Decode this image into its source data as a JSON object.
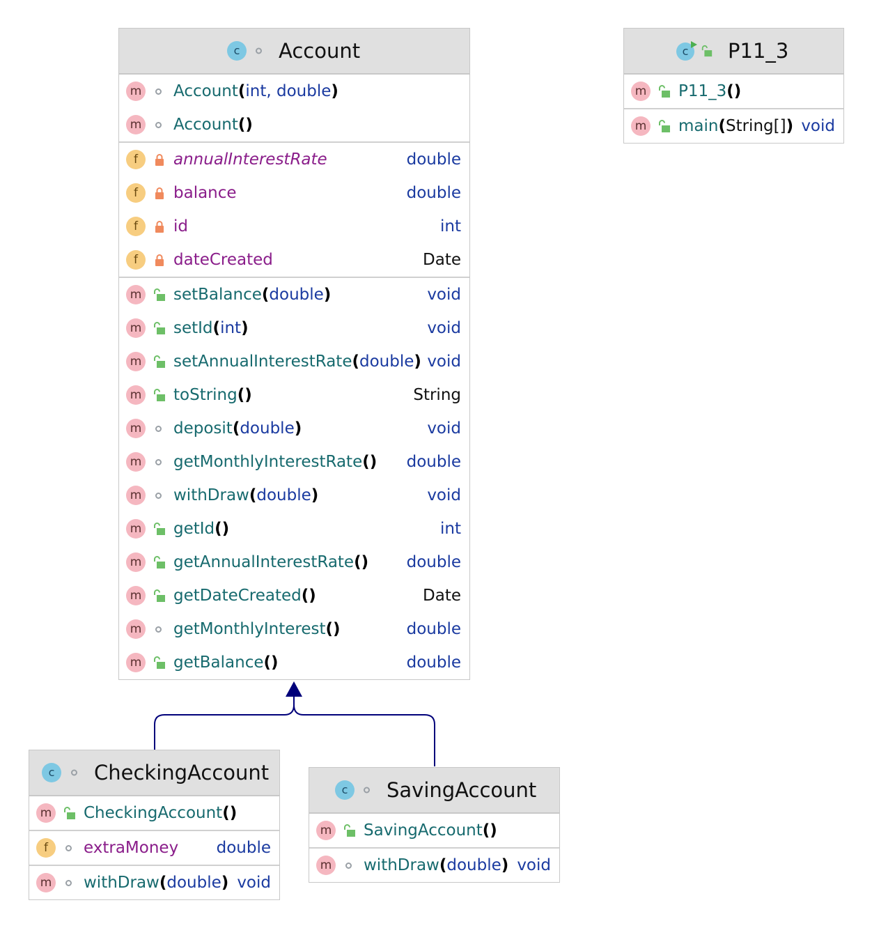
{
  "classes": {
    "account": {
      "name": "Account",
      "constructors": [
        {
          "name": "Account",
          "params": "int, double"
        },
        {
          "name": "Account",
          "params": ""
        }
      ],
      "fields": [
        {
          "name": "annualInterestRate",
          "type": "double"
        },
        {
          "name": "balance",
          "type": "double"
        },
        {
          "name": "id",
          "type": "int"
        },
        {
          "name": "dateCreated",
          "type": "Date"
        }
      ],
      "methods": [
        {
          "name": "setBalance",
          "params": "double",
          "type": "void"
        },
        {
          "name": "setId",
          "params": "int",
          "type": "void"
        },
        {
          "name": "setAnnualInterestRate",
          "params": "double",
          "type": "void"
        },
        {
          "name": "toString",
          "params": "",
          "type": "String"
        },
        {
          "name": "deposit",
          "params": "double",
          "type": "void"
        },
        {
          "name": "getMonthlyInterestRate",
          "params": "",
          "type": "double"
        },
        {
          "name": "withDraw",
          "params": "double",
          "type": "void"
        },
        {
          "name": "getId",
          "params": "",
          "type": "int"
        },
        {
          "name": "getAnnualInterestRate",
          "params": "",
          "type": "double"
        },
        {
          "name": "getDateCreated",
          "params": "",
          "type": "Date"
        },
        {
          "name": "getMonthlyInterest",
          "params": "",
          "type": "double"
        },
        {
          "name": "getBalance",
          "params": "",
          "type": "double"
        }
      ]
    },
    "p11_3": {
      "name": "P11_3",
      "constructors": [
        {
          "name": "P11_3",
          "params": ""
        }
      ],
      "methods": [
        {
          "name": "main",
          "params": "String[]",
          "type": "void"
        }
      ]
    },
    "checking": {
      "name": "CheckingAccount",
      "constructors": [
        {
          "name": "CheckingAccount",
          "params": ""
        }
      ],
      "fields": [
        {
          "name": "extraMoney",
          "type": "double"
        }
      ],
      "methods": [
        {
          "name": "withDraw",
          "params": "double",
          "type": "void"
        }
      ]
    },
    "saving": {
      "name": "SavingAccount",
      "constructors": [
        {
          "name": "SavingAccount",
          "params": ""
        }
      ],
      "methods": [
        {
          "name": "withDraw",
          "params": "double",
          "type": "void"
        }
      ]
    }
  },
  "icons": {
    "class_letter": "c",
    "method_letter": "m",
    "field_letter": "f"
  },
  "colors": {
    "method_icon": "#f5b7c0",
    "field_icon": "#f7cd80",
    "class_icon": "#7ec8e3",
    "inheritance_arrow": "#00007a",
    "method_name": "#176a6e",
    "field_name": "#8a1d8a",
    "type_name": "#1a3aa0"
  }
}
